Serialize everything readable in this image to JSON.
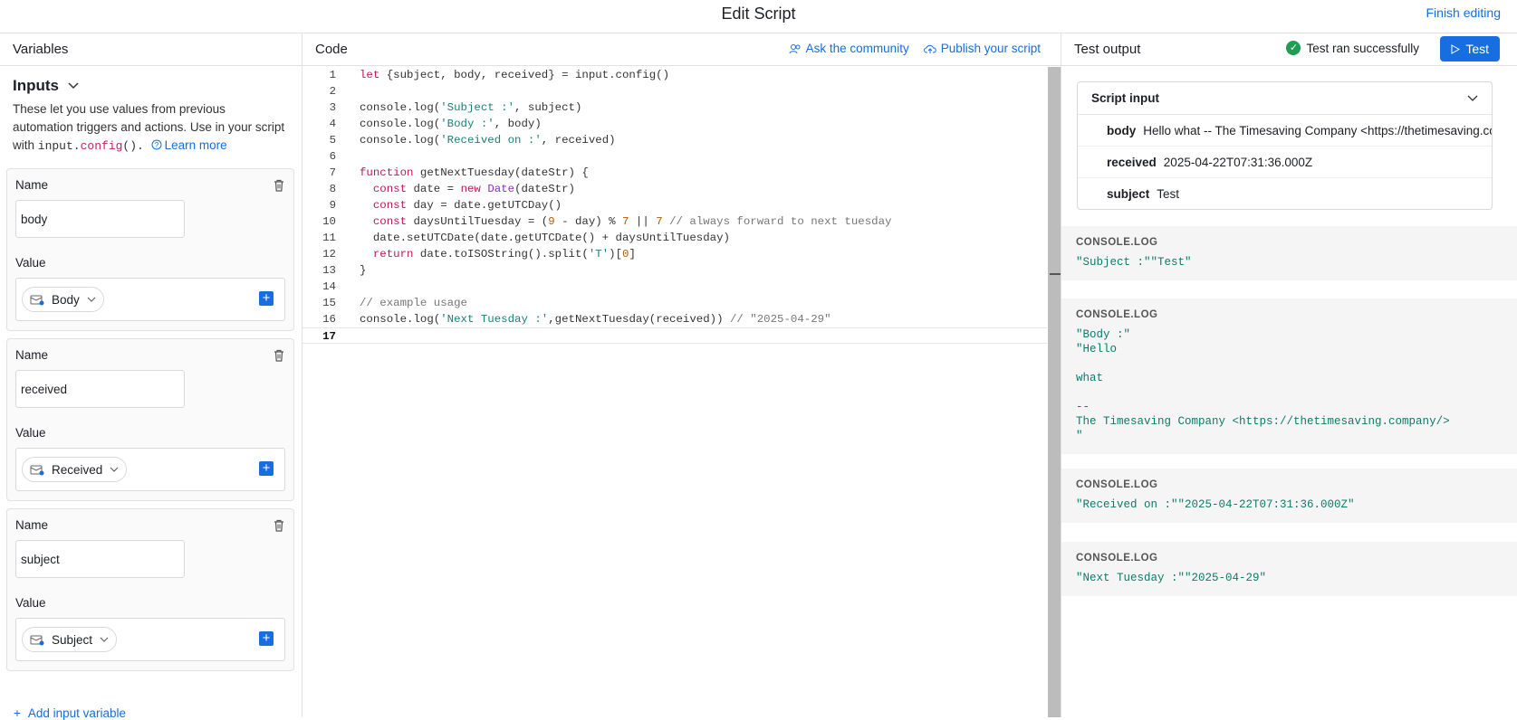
{
  "header": {
    "title": "Edit Script",
    "finish_label": "Finish editing"
  },
  "left": {
    "title": "Variables",
    "inputs_title": "Inputs",
    "desc_text": "These let you use values from previous automation triggers and actions. Use in your script with",
    "desc_code_a": "input.",
    "desc_code_b": "config",
    "desc_code_c": "().",
    "learn_more": "Learn more",
    "name_label": "Name",
    "value_label": "Value",
    "vars": [
      {
        "name": "body",
        "value": "Body"
      },
      {
        "name": "received",
        "value": "Received"
      },
      {
        "name": "subject",
        "value": "Subject"
      }
    ],
    "add_label": "Add input variable"
  },
  "mid": {
    "title": "Code",
    "ask_label": "Ask the community",
    "publish_label": "Publish your script",
    "lines": [
      "let {subject, body, received} = input.config()",
      "",
      "console.log('Subject :', subject)",
      "console.log('Body :', body)",
      "console.log('Received on :', received)",
      "",
      "function getNextTuesday(dateStr) {",
      "  const date = new Date(dateStr)",
      "  const day = date.getUTCDay()",
      "  const daysUntilTuesday = (9 - day) % 7 || 7 // always forward to next tuesday",
      "  date.setUTCDate(date.getUTCDate() + daysUntilTuesday)",
      "  return date.toISOString().split('T')[0]",
      "}",
      "",
      "// example usage",
      "console.log('Next Tuesday :',getNextTuesday(received)) // \"2025-04-29\"",
      ""
    ]
  },
  "right": {
    "title": "Test output",
    "status": "Test ran successfully",
    "test_label": "Test",
    "script_input_label": "Script input",
    "inputs": [
      {
        "key": "body",
        "value": "Hello what -- The Timesaving Company <https://thetimesaving.company/>"
      },
      {
        "key": "received",
        "value": "2025-04-22T07:31:36.000Z"
      },
      {
        "key": "subject",
        "value": "Test"
      }
    ],
    "logs": [
      {
        "tag": "CONSOLE.LOG",
        "text": "\"Subject :\"\"Test\""
      },
      {
        "tag": "CONSOLE.LOG",
        "text": "\"Body :\"\n\"Hello\n\nwhat\n\n--\nThe Timesaving Company <https://thetimesaving.company/>\n\""
      },
      {
        "tag": "CONSOLE.LOG",
        "text": "\"Received on :\"\"2025-04-22T07:31:36.000Z\""
      },
      {
        "tag": "CONSOLE.LOG",
        "text": "\"Next Tuesday :\"\"2025-04-29\""
      }
    ]
  }
}
